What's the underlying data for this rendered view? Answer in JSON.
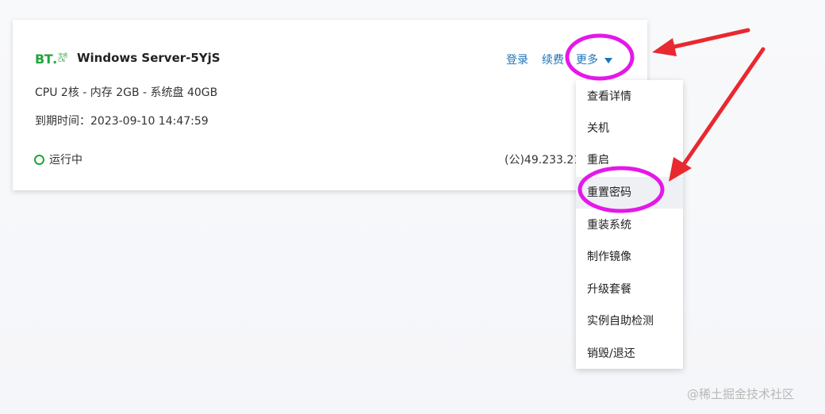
{
  "logo": {
    "main": "BT",
    "small_top": "宝塔",
    "small_bottom": "CN"
  },
  "instance": {
    "name": "Windows Server-5YjS",
    "spec": "CPU 2核 - 内存 2GB - 系统盘 40GB",
    "expire": "到期时间：2023-09-10 14:47:59",
    "status": "运行中",
    "ip": "(公)49.233.21"
  },
  "actions": {
    "login": "登录",
    "renew": "续费",
    "more": "更多"
  },
  "menu": {
    "items": [
      "查看详情",
      "关机",
      "重启",
      "重置密码",
      "重装系统",
      "制作镜像",
      "升级套餐",
      "实例自助检测",
      "销毁/退还"
    ],
    "active_index": 3
  },
  "watermark": "@稀土掘金技术社区",
  "colors": {
    "brand_green": "#20a53a",
    "link_blue": "#1c73b8",
    "annotation_magenta": "#e418e8",
    "annotation_red": "#e8292f"
  }
}
